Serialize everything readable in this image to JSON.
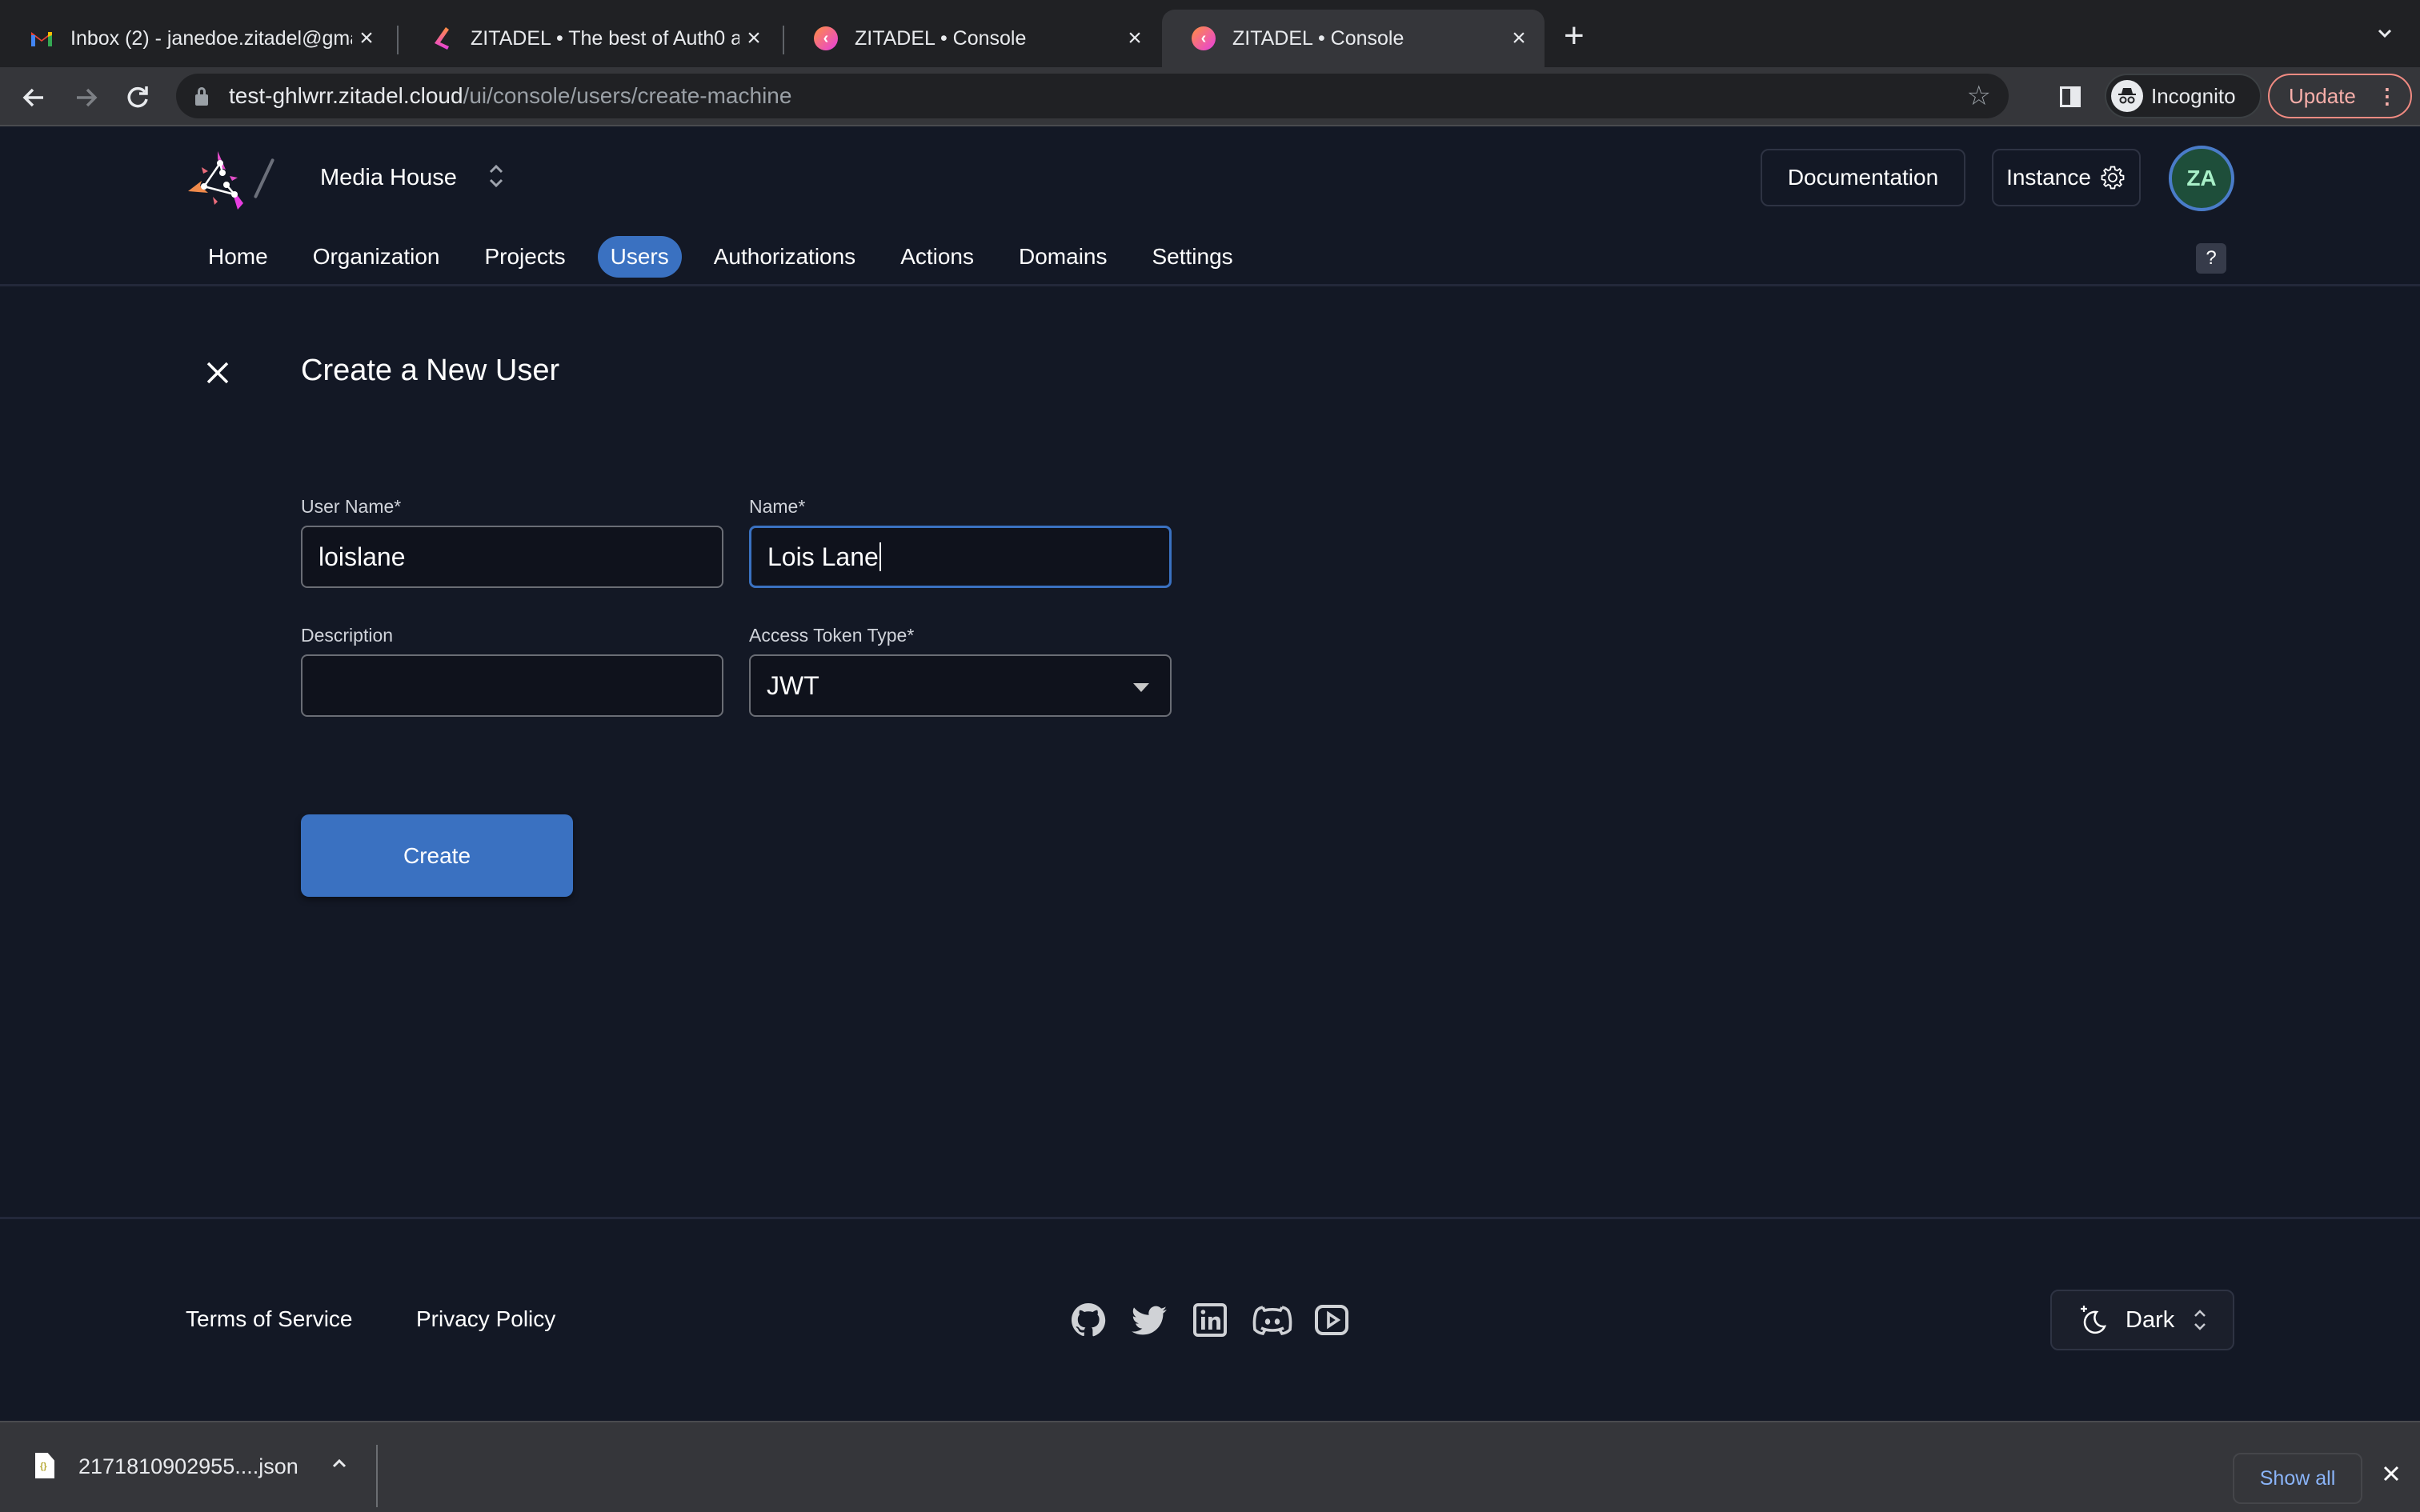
{
  "browser": {
    "tabs": [
      {
        "title": "Inbox (2) - janedoe.zitadel@gmail.com",
        "icon": "gmail-icon",
        "active": false
      },
      {
        "title": "ZITADEL • The best of Auth0 and Keycloak",
        "icon": "zitadel-icon",
        "active": false
      },
      {
        "title": "ZITADEL • Console",
        "icon": "zitadel-console-icon",
        "active": false
      },
      {
        "title": "ZITADEL • Console",
        "icon": "zitadel-console-icon",
        "active": true
      }
    ],
    "new_tab_label": "+",
    "url_host": "test-ghlwrr.zitadel.cloud",
    "url_path": "/ui/console/users/create-machine",
    "incognito_label": "Incognito",
    "update_label": "Update"
  },
  "header": {
    "org_name": "Media House",
    "documentation_label": "Documentation",
    "instance_label": "Instance",
    "avatar_initials": "ZA",
    "help_label": "?",
    "nav": [
      {
        "label": "Home",
        "active": false
      },
      {
        "label": "Organization",
        "active": false
      },
      {
        "label": "Projects",
        "active": false
      },
      {
        "label": "Users",
        "active": true
      },
      {
        "label": "Authorizations",
        "active": false
      },
      {
        "label": "Actions",
        "active": false
      },
      {
        "label": "Domains",
        "active": false
      },
      {
        "label": "Settings",
        "active": false
      }
    ]
  },
  "form": {
    "title": "Create a New User",
    "username_label": "User Name*",
    "username_value": "loislane",
    "name_label": "Name*",
    "name_value": "Lois Lane",
    "description_label": "Description",
    "description_value": "",
    "token_type_label": "Access Token Type*",
    "token_type_value": "JWT",
    "create_label": "Create"
  },
  "footer": {
    "terms_label": "Terms of Service",
    "privacy_label": "Privacy Policy",
    "socials": [
      "github",
      "twitter",
      "linkedin",
      "discord",
      "youtube"
    ],
    "theme_label": "Dark"
  },
  "downloads": {
    "file_name": "2171810902955....json",
    "show_all_label": "Show all"
  },
  "colors": {
    "accent": "#3a71c1",
    "background": "#131825",
    "avatar_bg": "#1e4e3a"
  }
}
